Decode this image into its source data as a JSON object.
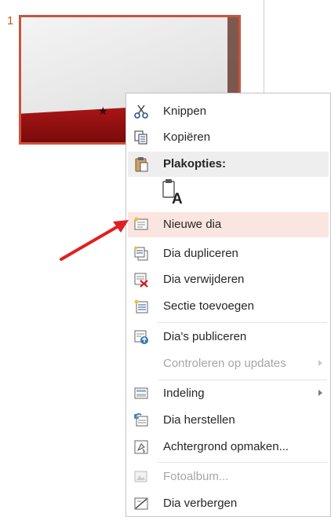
{
  "slide": {
    "number": "1"
  },
  "context_menu": {
    "items": [
      {
        "label": "Knippen",
        "icon": "scissors-icon",
        "enabled": true
      },
      {
        "label": "Kopiëren",
        "icon": "copy-icon",
        "enabled": true
      },
      {
        "label": "Plakopties:",
        "icon": "paste-icon",
        "enabled": true
      },
      {
        "label": "A",
        "icon": "paste-keep-text-only-icon",
        "enabled": true
      },
      {
        "label": "Nieuwe dia",
        "icon": "new-slide-icon",
        "enabled": true,
        "highlighted": true
      },
      {
        "label": "Dia dupliceren",
        "icon": "duplicate-slide-icon",
        "enabled": true
      },
      {
        "label": "Dia verwijderen",
        "icon": "delete-slide-icon",
        "enabled": true
      },
      {
        "label": "Sectie toevoegen",
        "icon": "add-section-icon",
        "enabled": true
      },
      {
        "label": "Dia's publiceren",
        "icon": "publish-slides-icon",
        "enabled": true
      },
      {
        "label": "Controleren op updates",
        "icon": "",
        "enabled": false,
        "submenu": true
      },
      {
        "label": "Indeling",
        "icon": "layout-icon",
        "enabled": true,
        "submenu": true
      },
      {
        "label": "Dia herstellen",
        "icon": "reset-slide-icon",
        "enabled": true
      },
      {
        "label": "Achtergrond opmaken...",
        "icon": "format-background-icon",
        "enabled": true
      },
      {
        "label": "Fotoalbum...",
        "icon": "photo-album-icon",
        "enabled": false
      },
      {
        "label": "Dia verbergen",
        "icon": "hide-slide-icon",
        "enabled": true
      }
    ]
  },
  "colors": {
    "highlight": "#fbe5e0",
    "slide_border": "#c8553d",
    "arrow": "#e02020"
  }
}
